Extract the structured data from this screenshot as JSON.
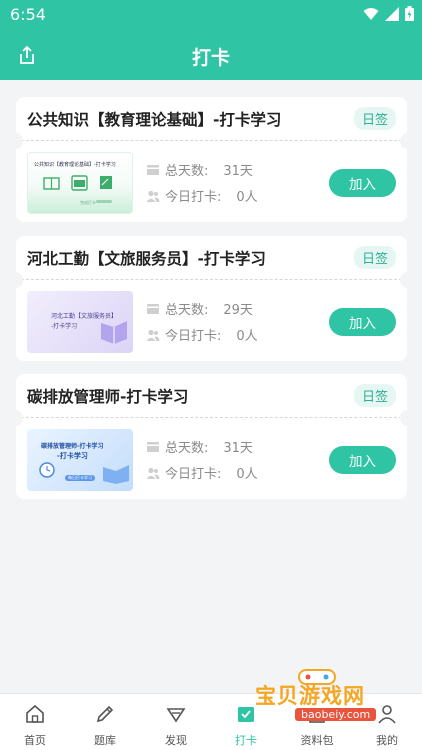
{
  "status": {
    "time": "6:54"
  },
  "header": {
    "title": "打卡"
  },
  "cards": [
    {
      "title": "公共知识【教育理论基础】-打卡学习",
      "badge": "日签",
      "days_label": "总天数:",
      "days_value": "31天",
      "today_label": "今日打卡:",
      "today_value": "0人",
      "button": "加入",
      "thumb": {
        "line1": "公共知识【教育理论基础】-打卡学习",
        "extra": "完成打卡",
        "theme": "green"
      }
    },
    {
      "title": "河北工勤【文旅服务员】-打卡学习",
      "badge": "日签",
      "days_label": "总天数:",
      "days_value": "29天",
      "today_label": "今日打卡:",
      "today_value": "0人",
      "button": "加入",
      "thumb": {
        "line1": "河北工勤【文旅服务员】",
        "line2": "-打卡学习",
        "theme": "purple"
      }
    },
    {
      "title": "碳排放管理师-打卡学习",
      "badge": "日签",
      "days_label": "总天数:",
      "days_value": "31天",
      "today_label": "今日打卡:",
      "today_value": "0人",
      "button": "加入",
      "thumb": {
        "line1": "碳排放管理师-打卡学习",
        "line2": "-打卡学习",
        "extra": "每日打卡学习",
        "theme": "blue"
      }
    }
  ],
  "tabbar": {
    "items": [
      {
        "label": "首页",
        "icon": "home-icon"
      },
      {
        "label": "题库",
        "icon": "pencil-icon"
      },
      {
        "label": "发现",
        "icon": "discover-icon"
      },
      {
        "label": "打卡",
        "icon": "checkin-icon",
        "active": true
      },
      {
        "label": "资料包",
        "icon": "package-icon"
      },
      {
        "label": "我的",
        "icon": "user-icon"
      }
    ]
  },
  "watermark": {
    "text": "宝贝游戏网",
    "url": "baobeiy.com"
  },
  "colors": {
    "primary": "#2ec4a4",
    "background": "#f3f4f6"
  }
}
